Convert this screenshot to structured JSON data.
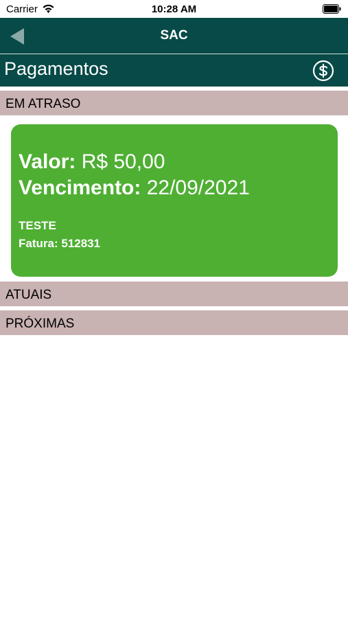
{
  "status_bar": {
    "carrier": "Carrier",
    "time": "10:28 AM"
  },
  "nav": {
    "title": "SAC",
    "color": "#074a47"
  },
  "header": {
    "title": "Pagamentos",
    "icon": "dollar-circle-icon"
  },
  "sections": {
    "overdue": "EM ATRASO",
    "current": "ATUAIS",
    "upcoming": "PRÓXIMAS",
    "color": "#c9b2b2"
  },
  "payment": {
    "value_label": "Valor:",
    "value": "R$ 50,00",
    "due_label": "Vencimento:",
    "due_date": "22/09/2021",
    "description": "TESTE",
    "invoice_label": "Fatura:",
    "invoice_number": "512831",
    "color": "#4faf33"
  }
}
